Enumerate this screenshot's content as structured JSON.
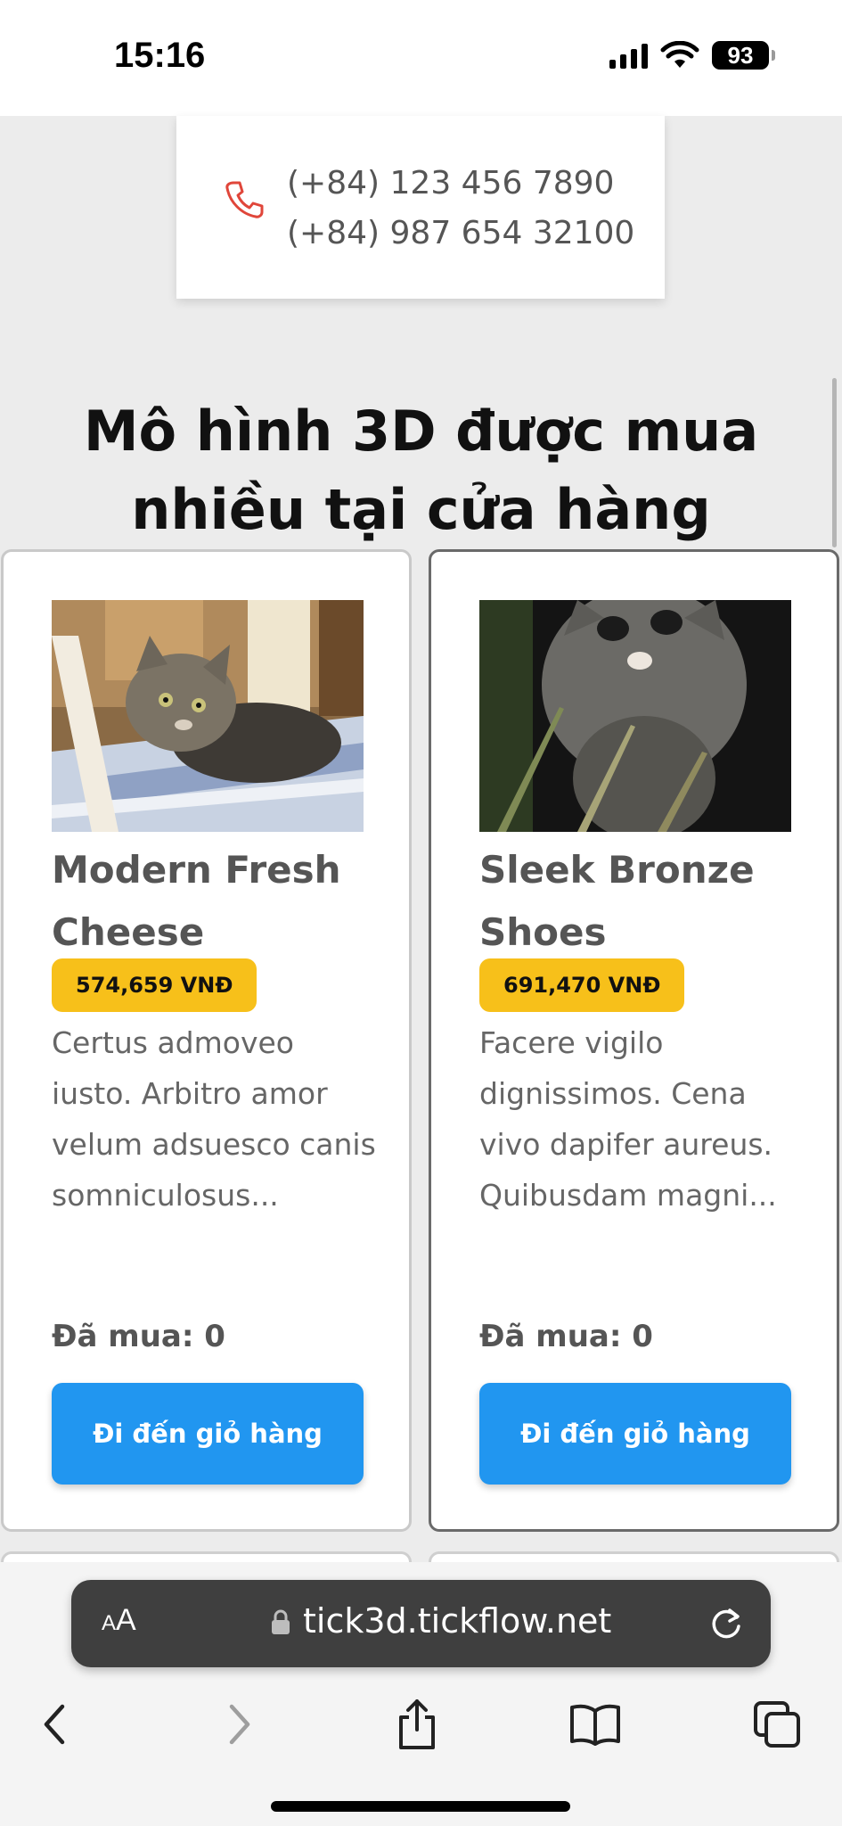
{
  "status_bar": {
    "time": "15:16",
    "battery": "93"
  },
  "contact": {
    "phones": [
      "(+84) 123 456 7890",
      "(+84) 987 654 32100"
    ]
  },
  "section": {
    "title": "Mô hình 3D được mua nhiều tại cửa hàng"
  },
  "products": [
    {
      "title": "Modern Fresh Cheese",
      "price": "574,659 VNĐ",
      "description": "Certus admoveo iusto. Arbitro amor velum adsuesco canis somniculosus...",
      "bought": "Đã mua: 0",
      "button": "Đi đến giỏ hàng"
    },
    {
      "title": "Sleek Bronze Shoes",
      "price": "691,470 VNĐ",
      "description": "Facere vigilo dignissimos. Cena vivo dapifer aureus. Quibusdam magni...",
      "bought": "Đã mua: 0",
      "button": "Đi đến giỏ hàng"
    }
  ],
  "browser": {
    "aa_label_small": "A",
    "aa_label_large": "A",
    "url": "tick3d.tickflow.net"
  },
  "colors": {
    "accent_button": "#2196f0",
    "price_badge": "#f7c01a",
    "phone_icon": "#e0463a"
  },
  "icons": {
    "phone": "phone-icon",
    "lock": "lock-icon",
    "reload": "reload-icon",
    "back": "chevron-left-icon",
    "forward": "chevron-right-icon",
    "share": "share-icon",
    "bookmarks": "book-icon",
    "tabs": "tabs-icon"
  }
}
